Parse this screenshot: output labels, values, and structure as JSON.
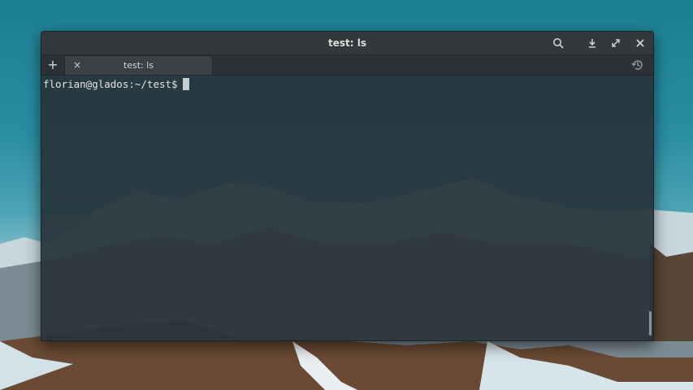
{
  "window": {
    "title": "test: ls",
    "controls": {
      "search_icon": "search-icon",
      "download_icon": "download-icon",
      "maximize_icon": "maximize-icon",
      "close_icon": "close-icon"
    }
  },
  "tabs": {
    "new_tab_symbol": "+",
    "items": [
      {
        "close_symbol": "×",
        "label": "test: ls",
        "active": true
      }
    ],
    "history_icon": "history-icon"
  },
  "terminal": {
    "prompt": "florian@glados:~/test$"
  }
}
